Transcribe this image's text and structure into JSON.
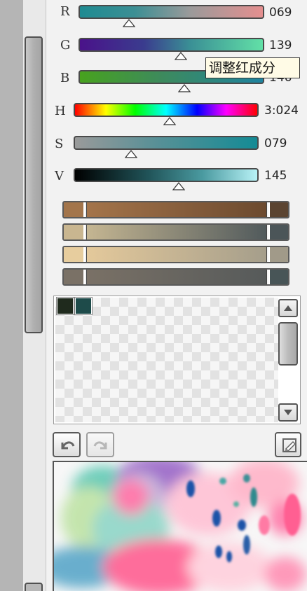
{
  "sliders": [
    {
      "key": "R",
      "label": "R",
      "value": "069",
      "position": 0.27
    },
    {
      "key": "G",
      "label": "G",
      "value": "139",
      "position": 0.55
    },
    {
      "key": "B",
      "label": "B",
      "value": "146",
      "position": 0.57
    },
    {
      "key": "H",
      "label": "H",
      "value": "3:024",
      "position": 0.52
    },
    {
      "key": "S",
      "label": "S",
      "value": "079",
      "position": 0.31
    },
    {
      "key": "V",
      "label": "V",
      "value": "145",
      "position": 0.57
    }
  ],
  "tooltip": {
    "text": "调整红成分"
  },
  "colors": {
    "swatch_rows": [
      {
        "left": "#a3754b",
        "mid_from": "#a4744a",
        "mid_to": "#6c4a2f",
        "right": "#5b4431"
      },
      {
        "left": "#c9b690",
        "mid_from": "#c5b692",
        "mid_to": "#515a5c",
        "right": "#4b5558"
      },
      {
        "left": "#e7cd9e",
        "mid_from": "#e4c99b",
        "mid_to": "#a59e8b",
        "right": "#a19a89"
      },
      {
        "left": "#7a7166",
        "mid_from": "#7a7166",
        "mid_to": "#565a5a",
        "right": "#485557"
      }
    ],
    "palette_swatches": [
      "#1f2a1d",
      "#1e4b4a"
    ]
  },
  "icons": {
    "undo": "undo-arrow-icon",
    "redo": "redo-arrow-icon",
    "clear": "eraser-icon",
    "scroll_up": "triangle-up-icon",
    "scroll_down": "triangle-down-icon"
  }
}
